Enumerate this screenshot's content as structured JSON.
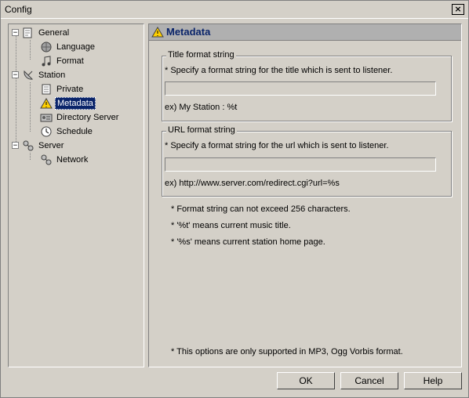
{
  "window": {
    "title": "Config",
    "close_label": "×"
  },
  "tree": {
    "nodes": [
      {
        "label": "General",
        "icon": "folder-icon",
        "expander": "−"
      },
      {
        "label": "Language",
        "icon": "globe-icon"
      },
      {
        "label": "Format",
        "icon": "music-note-icon"
      },
      {
        "label": "Station",
        "icon": "satellite-dish-icon",
        "expander": "−"
      },
      {
        "label": "Private",
        "icon": "page-icon"
      },
      {
        "label": "Metadata",
        "icon": "warning-icon",
        "selected": true
      },
      {
        "label": "Directory Server",
        "icon": "directory-icon"
      },
      {
        "label": "Schedule",
        "icon": "clock-icon"
      },
      {
        "label": "Server",
        "icon": "network-icon",
        "expander": "−"
      },
      {
        "label": "Network",
        "icon": "network-icon"
      }
    ]
  },
  "panel": {
    "title": "Metadata",
    "title_group": {
      "legend": "Title format string",
      "description": "* Specify a format string for the title which is sent to listener.",
      "value": "",
      "example": "ex) My Station : %t"
    },
    "url_group": {
      "legend": "URL format string",
      "description": "* Specify a format string for the url which is sent to listener.",
      "value": "",
      "example": "ex) http://www.server.com/redirect.cgi?url=%s"
    },
    "notes": [
      "* Format string can not exceed 256 characters.",
      "* '%t' means current music title.",
      "* '%s' means current station home page."
    ],
    "footer_note": "* This options are only supported in MP3, Ogg Vorbis format."
  },
  "buttons": {
    "ok": "OK",
    "cancel": "Cancel",
    "help": "Help"
  },
  "colors": {
    "selection": "#0a246a",
    "face": "#d4d0c8",
    "header": "#b0b0b0"
  }
}
